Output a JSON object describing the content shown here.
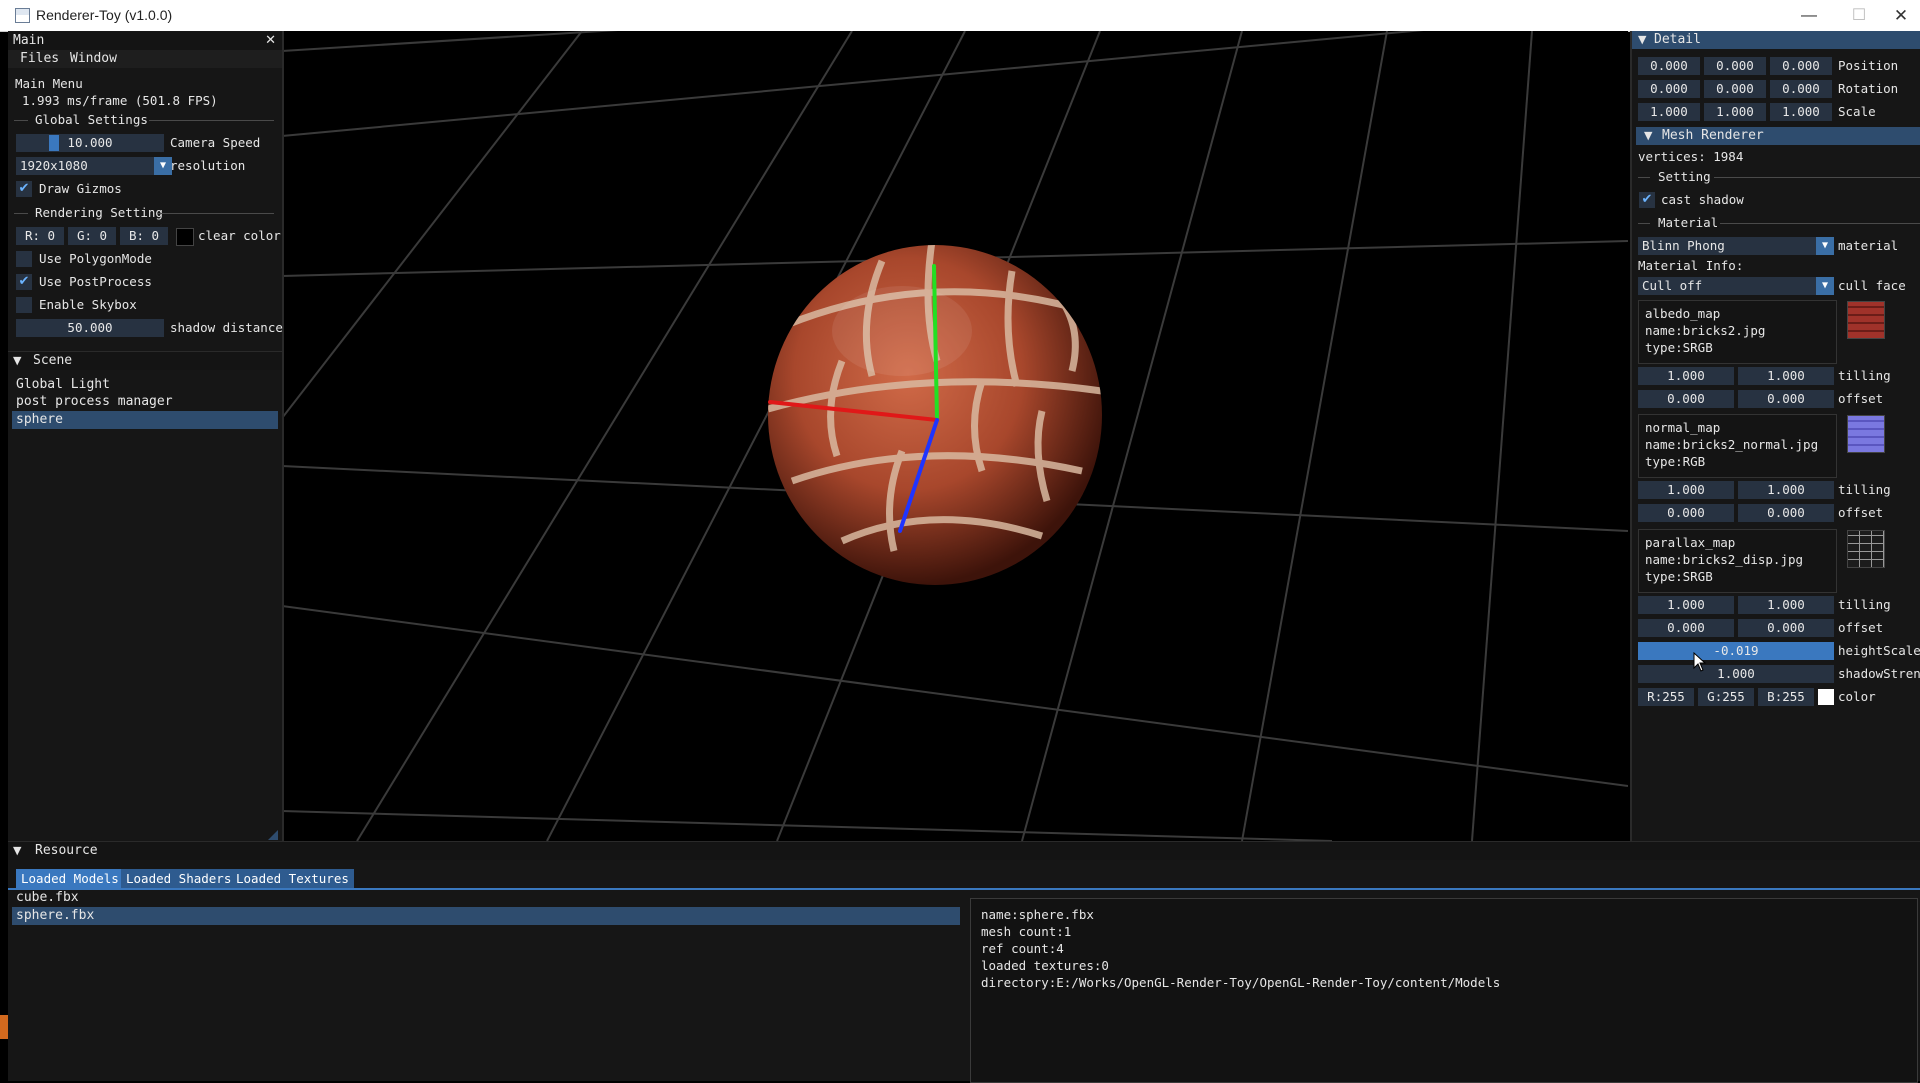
{
  "window": {
    "title": "Renderer-Toy (v1.0.0)",
    "minimize": "—",
    "maximize": "☐",
    "close": "✕"
  },
  "main": {
    "title": "Main",
    "close": "✕",
    "menu": [
      "Files",
      "Window"
    ],
    "main_menu": "Main Menu",
    "fps": "1.993 ms/frame (501.8 FPS)",
    "global_settings": "Global Settings",
    "camera_speed": {
      "value": "10.000",
      "label": "Camera Speed",
      "fraction": 0.1
    },
    "resolution": {
      "value": "1920x1080",
      "label": "resolution"
    },
    "draw_gizmos": {
      "label": "Draw Gizmos",
      "checked": true
    },
    "rendering_setting": "Rendering Setting",
    "clear_color": {
      "r": "R:  0",
      "g": "G:  0",
      "b": "B:  0",
      "label": "clear color",
      "swatch": "#000000"
    },
    "use_polygon_mode": {
      "label": "Use PolygonMode",
      "checked": false
    },
    "use_postprocess": {
      "label": "Use PostProcess",
      "checked": true
    },
    "enable_skybox": {
      "label": "Enable Skybox",
      "checked": false
    },
    "shadow_distance": {
      "value": "50.000",
      "label": "shadow distance"
    }
  },
  "scene": {
    "title": "Scene",
    "items": [
      "Global Light",
      "post process manager",
      "sphere"
    ],
    "selected": 2
  },
  "detail": {
    "title": "Detail",
    "transform": [
      {
        "label": "Position",
        "values": [
          "0.000",
          "0.000",
          "0.000"
        ]
      },
      {
        "label": "Rotation",
        "values": [
          "0.000",
          "0.000",
          "0.000"
        ]
      },
      {
        "label": "Scale",
        "values": [
          "1.000",
          "1.000",
          "1.000"
        ]
      }
    ],
    "mesh_renderer": "Mesh Renderer",
    "vertices": "vertices: 1984",
    "setting": "Setting",
    "cast_shadow": {
      "label": "cast shadow",
      "checked": true
    },
    "material_section": "Material",
    "material": {
      "value": "Blinn Phong",
      "label": "material"
    },
    "material_info": "Material Info:",
    "cull_face": {
      "value": "Cull off",
      "label": "cull face"
    },
    "textures": [
      {
        "name": "albedo_map",
        "file": "name:bricks2.jpg",
        "type": "type:SRGB",
        "tilling": [
          "1.000",
          "1.000"
        ],
        "offset": [
          "0.000",
          "0.000"
        ],
        "thumb_color": "#a0322a"
      },
      {
        "name": "normal_map",
        "file": "name:bricks2_normal.jpg",
        "type": "type:RGB",
        "tilling": [
          "1.000",
          "1.000"
        ],
        "offset": [
          "0.000",
          "0.000"
        ],
        "thumb_color": "#7a78e0"
      },
      {
        "name": "parallax_map",
        "file": "name:bricks2_disp.jpg",
        "type": "type:SRGB",
        "tilling": [
          "1.000",
          "1.000"
        ],
        "offset": [
          "0.000",
          "0.000"
        ],
        "thumb_color": "#1c1c1c"
      }
    ],
    "tilling_label": "tilling",
    "offset_label": "offset",
    "height_scale": {
      "value": "-0.019",
      "label": "heightScale"
    },
    "shadow_strength": {
      "value": "1.000",
      "label": "shadowStreng"
    },
    "color": {
      "r": "R:255",
      "g": "G:255",
      "b": "B:255",
      "label": "color",
      "swatch": "#ffffff"
    }
  },
  "resource": {
    "title": "Resource",
    "tabs": [
      "Loaded Models",
      "Loaded Shaders",
      "Loaded Textures"
    ],
    "active_tab": 0,
    "models": [
      "cube.fbx",
      "sphere.fbx"
    ],
    "selected_model": 1,
    "info": [
      "name:sphere.fbx",
      "mesh count:1",
      "ref count:4",
      "loaded textures:0",
      "directory:E:/Works/OpenGL-Render-Toy/OpenGL-Render-Toy/content/Models"
    ]
  },
  "colors": {
    "accent": "#3a78bf",
    "header": "#2e4c6e",
    "frame": "#273241",
    "panel": "#161616"
  }
}
